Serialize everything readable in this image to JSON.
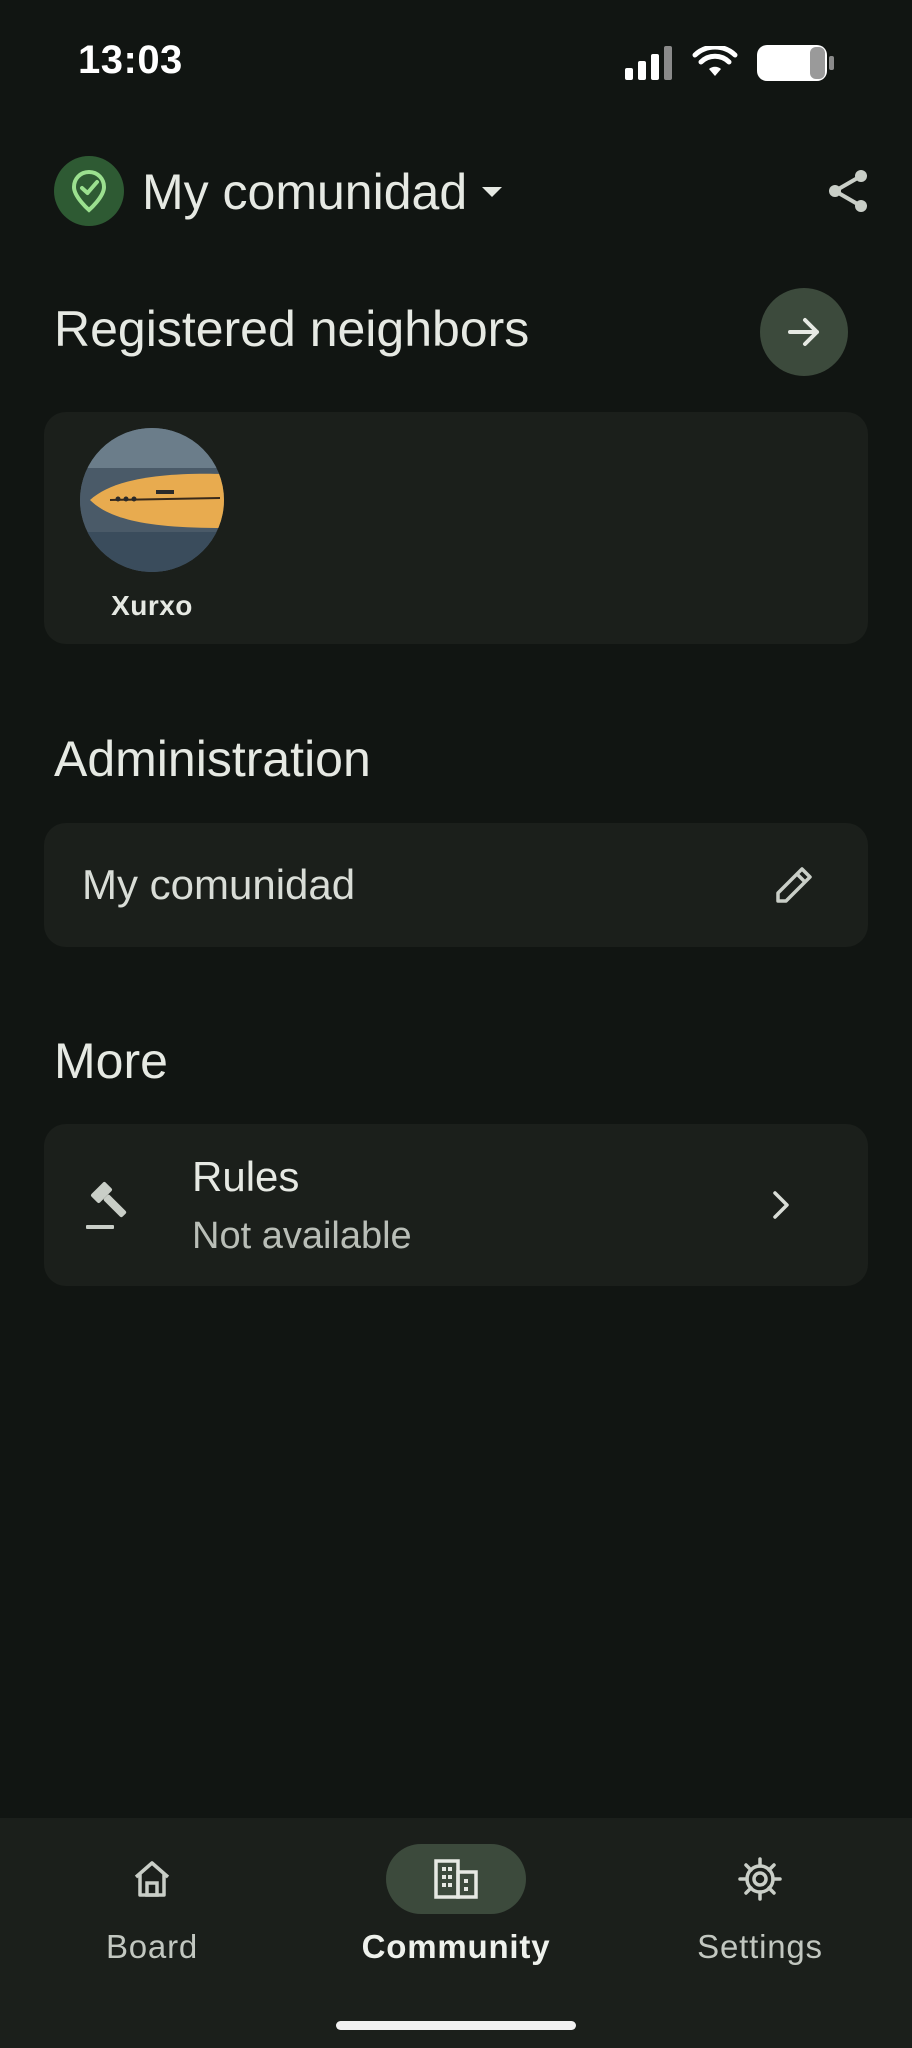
{
  "status_bar": {
    "time": "13:03",
    "icons": [
      "cellular-signal-icon",
      "wifi-icon",
      "battery-icon"
    ]
  },
  "header": {
    "logo_icon": "location-check-icon",
    "community_name": "My comunidad",
    "dropdown_icon": "caret-down-icon",
    "share_icon": "share-icon"
  },
  "registered_neighbors": {
    "title": "Registered neighbors",
    "arrow_icon": "arrow-right-icon",
    "neighbors": [
      {
        "name": "Xurxo",
        "avatar": "surfboard-photo"
      }
    ]
  },
  "administration": {
    "title": "Administration",
    "community_name": "My comunidad",
    "edit_icon": "pencil-icon"
  },
  "more": {
    "title": "More",
    "rules": {
      "title": "Rules",
      "subtitle": "Not available",
      "icon": "gavel-icon",
      "chevron_icon": "chevron-right-icon"
    }
  },
  "bottom_nav": {
    "items": [
      {
        "label": "Board",
        "icon": "home-icon",
        "active": false
      },
      {
        "label": "Community",
        "icon": "building-icon",
        "active": true
      },
      {
        "label": "Settings",
        "icon": "gear-icon",
        "active": false
      }
    ]
  },
  "colors": {
    "background": "#111512",
    "card": "#1b1f1b",
    "accent_pill": "#3c4a3c",
    "logo_bg": "#2e5a33",
    "logo_fg": "#9be08f"
  }
}
